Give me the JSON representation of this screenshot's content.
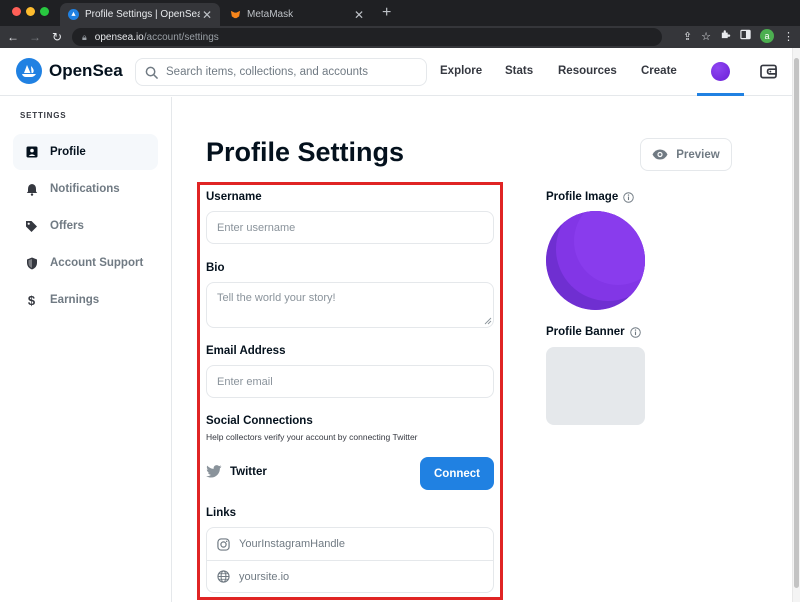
{
  "browser": {
    "tabs": [
      {
        "title": "Profile Settings | OpenSea",
        "active": true
      },
      {
        "title": "MetaMask",
        "active": false
      }
    ],
    "url_host": "opensea.io",
    "url_path": "/account/settings",
    "profile_initial": "a"
  },
  "header": {
    "logo_text": "OpenSea",
    "search_placeholder": "Search items, collections, and accounts",
    "nav": [
      "Explore",
      "Stats",
      "Resources",
      "Create"
    ]
  },
  "sidebar": {
    "heading": "SETTINGS",
    "items": [
      {
        "label": "Profile",
        "icon": "profile-icon",
        "active": true
      },
      {
        "label": "Notifications",
        "icon": "bell-icon",
        "active": false
      },
      {
        "label": "Offers",
        "icon": "tag-icon",
        "active": false
      },
      {
        "label": "Account Support",
        "icon": "shield-icon",
        "active": false
      },
      {
        "label": "Earnings",
        "icon": "dollar-icon",
        "active": false
      }
    ]
  },
  "main": {
    "title": "Profile Settings",
    "preview_label": "Preview",
    "username_label": "Username",
    "username_placeholder": "Enter username",
    "bio_label": "Bio",
    "bio_placeholder": "Tell the world your story!",
    "email_label": "Email Address",
    "email_placeholder": "Enter email",
    "social_label": "Social Connections",
    "social_hint": "Help collectors verify your account by connecting Twitter",
    "twitter_label": "Twitter",
    "connect_label": "Connect",
    "links_label": "Links",
    "instagram_placeholder": "YourInstagramHandle",
    "website_placeholder": "yoursite.io",
    "profile_image_label": "Profile Image",
    "profile_banner_label": "Profile Banner"
  },
  "colors": {
    "accent": "#2081e2",
    "highlight_border": "#e02424",
    "profile_purple": "#7d2ee0"
  }
}
